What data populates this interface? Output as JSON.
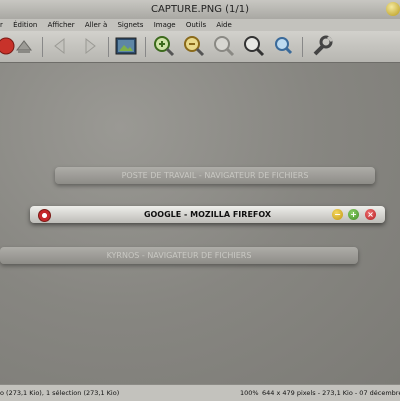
{
  "window": {
    "title": "CAPTURE.PNG  (1/1)"
  },
  "menu": {
    "items": [
      "r",
      "Édition",
      "Afficher",
      "Aller à",
      "Signets",
      "Image",
      "Outils",
      "Aide"
    ]
  },
  "toolbar": {
    "icons": [
      "stop-icon",
      "save-icon",
      "back-icon",
      "forward-icon",
      "fullscreen-icon",
      "zoom-in-icon",
      "zoom-out-icon",
      "zoom-fit-icon",
      "zoom-100-icon",
      "zoom-small-icon",
      "tools-icon"
    ]
  },
  "image": {
    "bar1": "POSTE DE TRAVAIL - NAVIGATEUR DE FICHIERS",
    "bar2": "GOOGLE - MOZILLA FIREFOX",
    "bar3": "KYRNOS - NAVIGATEUR DE FICHIERS"
  },
  "status": {
    "left": "o (273,1 Kio), 1 sélection (273,1 Kio)",
    "zoom": "100%",
    "info": "644 x 479 pixels - 273,1 Kio - 07 décembre 20"
  },
  "colors": {
    "minimize": "#d8b21a",
    "maximize": "#4a9a2c",
    "close": "#c4262a"
  }
}
